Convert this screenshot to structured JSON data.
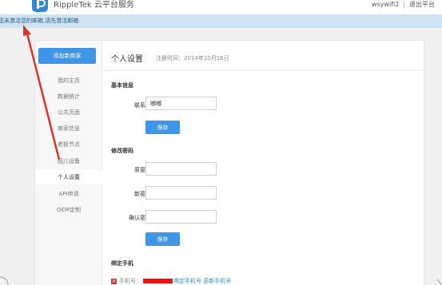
{
  "header": {
    "brand": "RippleTek 云平台服务",
    "username": "wsywifi2",
    "separator": "|",
    "logout": "退出平台"
  },
  "notice": {
    "text": "您未激活您的邮箱,请先激活邮箱"
  },
  "sidebar": {
    "add_button": "添加新商家",
    "items": [
      {
        "label": "我的主页"
      },
      {
        "label": "数据统计"
      },
      {
        "label": "公共页面"
      },
      {
        "label": "商家信息"
      },
      {
        "label": "老板节点"
      },
      {
        "label": "园儿设备"
      },
      {
        "label": "个人设置",
        "active": true
      },
      {
        "label": "API申请"
      },
      {
        "label": "OEM定制"
      }
    ]
  },
  "page": {
    "title": "个人设置",
    "registered": "注册时间：2014年10月16日"
  },
  "basic_info": {
    "section_title": "基本信息",
    "contact_label": "联系人",
    "contact_value": "嘟嘟",
    "save": "保存"
  },
  "password": {
    "section_title": "修改密码",
    "old_label": "原密码",
    "new_label": "新密码",
    "confirm_label": "确认密码",
    "save": "保存"
  },
  "phone": {
    "section_title": "绑定手机",
    "prefix": "手机号：",
    "bind_link": "绑定手机号",
    "update_link": "更新手机号"
  },
  "colors": {
    "accent": "#3f95e6",
    "notice_bg": "#cfe3f3",
    "annotation_arrow": "#e0322a"
  }
}
